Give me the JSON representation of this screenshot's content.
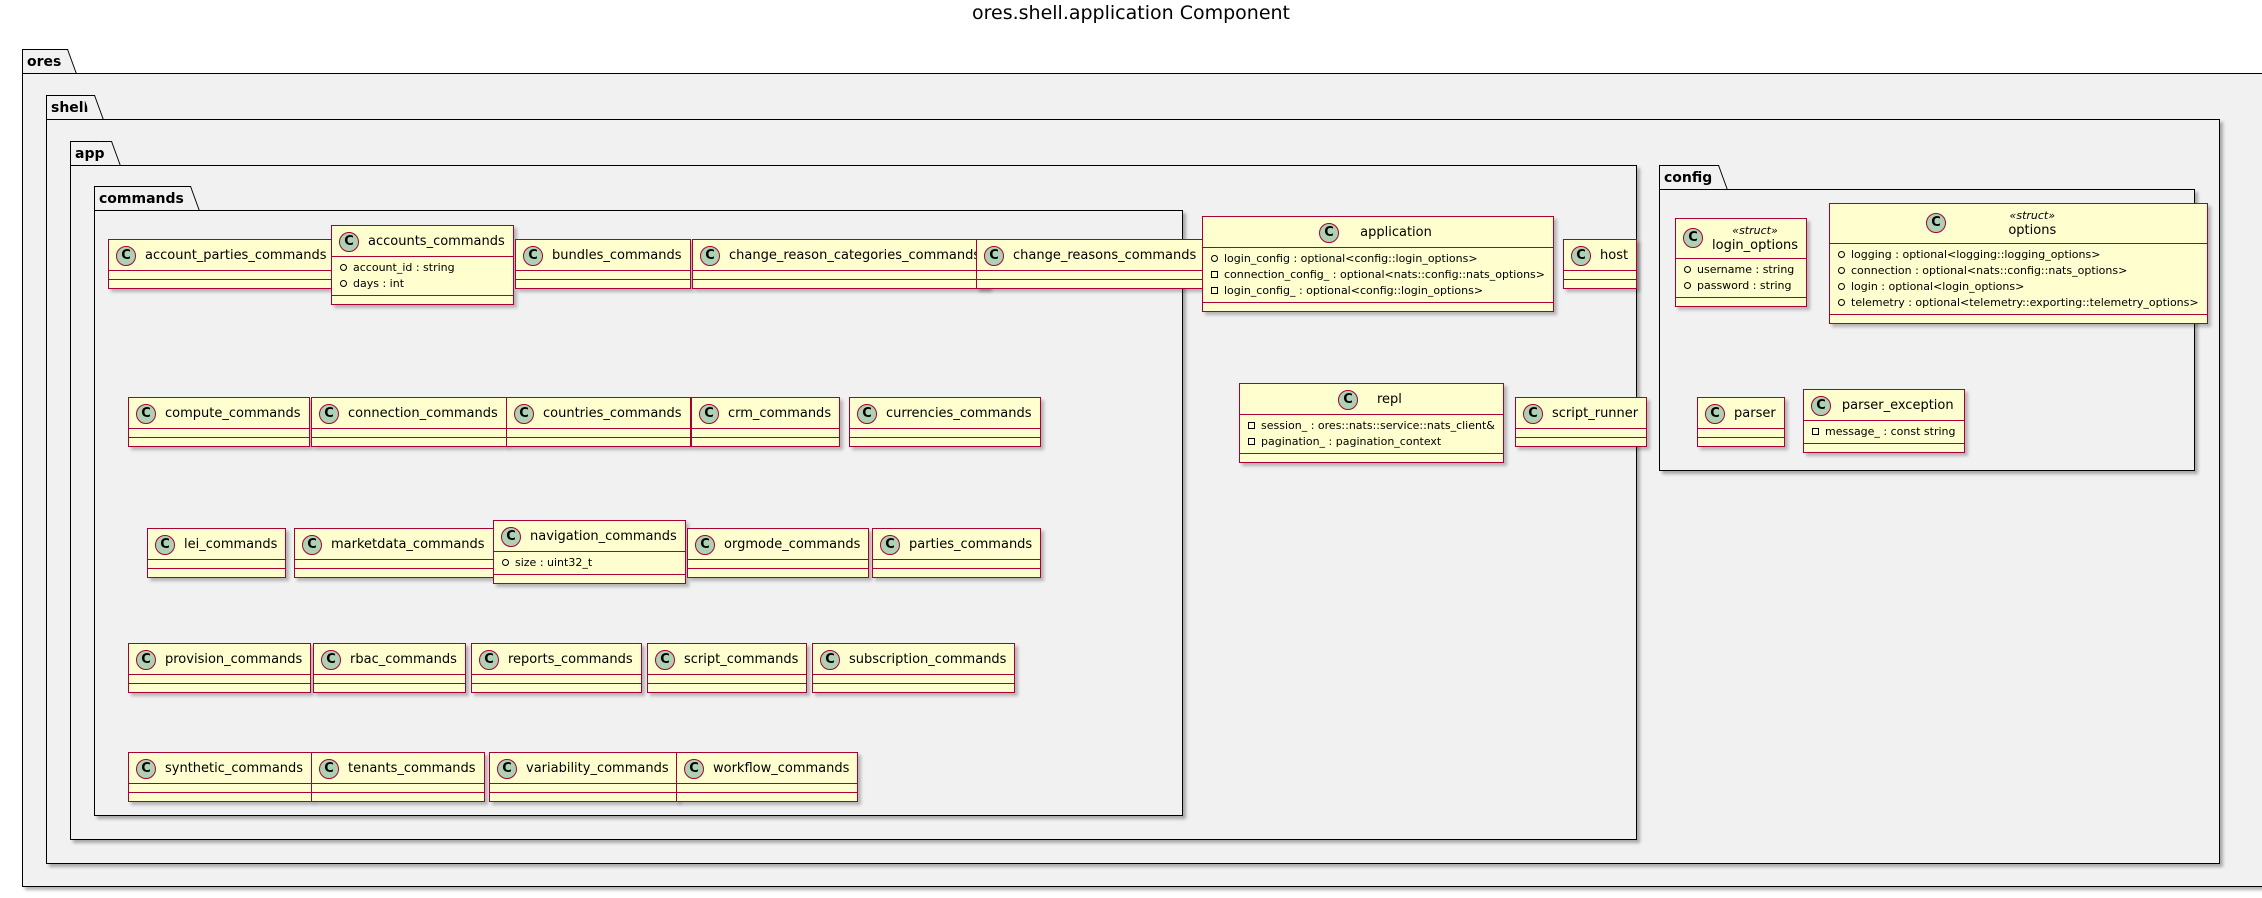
{
  "diagram_title": "ores.shell.application Component",
  "packages": {
    "ores": "ores",
    "shell": "shell",
    "app": "app",
    "commands": "commands",
    "config": "config"
  },
  "class_badge": "C",
  "commands": {
    "account_parties": "account_parties_commands",
    "accounts": {
      "name": "accounts_commands",
      "members": [
        {
          "vis": "public",
          "text": "account_id : string"
        },
        {
          "vis": "public",
          "text": "days : int"
        }
      ]
    },
    "bundles": "bundles_commands",
    "change_reason_categories": "change_reason_categories_commands",
    "change_reasons": "change_reasons_commands",
    "compute": "compute_commands",
    "connection": "connection_commands",
    "countries": "countries_commands",
    "crm": "crm_commands",
    "currencies": "currencies_commands",
    "lei": "lei_commands",
    "marketdata": "marketdata_commands",
    "navigation": {
      "name": "navigation_commands",
      "members": [
        {
          "vis": "public",
          "text": "size : uint32_t"
        }
      ]
    },
    "orgmode": "orgmode_commands",
    "parties": "parties_commands",
    "provision": "provision_commands",
    "rbac": "rbac_commands",
    "reports": "reports_commands",
    "script": "script_commands",
    "subscription": "subscription_commands",
    "synthetic": "synthetic_commands",
    "tenants": "tenants_commands",
    "variability": "variability_commands",
    "workflow": "workflow_commands"
  },
  "app_classes": {
    "application": {
      "name": "application",
      "members": [
        {
          "vis": "public",
          "text": "login_config : optional<config::login_options>"
        },
        {
          "vis": "private",
          "text": "connection_config_ : optional<nats::config::nats_options>"
        },
        {
          "vis": "private",
          "text": "login_config_ : optional<config::login_options>"
        }
      ]
    },
    "host": "host",
    "repl": {
      "name": "repl",
      "members": [
        {
          "vis": "private",
          "text": "session_ : ores::nats::service::nats_client&"
        },
        {
          "vis": "private",
          "text": "pagination_ : pagination_context"
        }
      ]
    },
    "script_runner": "script_runner"
  },
  "config_classes": {
    "login_options": {
      "stereotype": "«struct»",
      "name": "login_options",
      "members": [
        {
          "vis": "public",
          "text": "username : string"
        },
        {
          "vis": "public",
          "text": "password : string"
        }
      ]
    },
    "options": {
      "stereotype": "«struct»",
      "name": "options",
      "members": [
        {
          "vis": "public",
          "text": "logging : optional<logging::logging_options>"
        },
        {
          "vis": "public",
          "text": "connection : optional<nats::config::nats_options>"
        },
        {
          "vis": "public",
          "text": "login : optional<login_options>"
        },
        {
          "vis": "public",
          "text": "telemetry : optional<telemetry::exporting::telemetry_options>"
        }
      ]
    },
    "parser": "parser",
    "parser_exception": {
      "name": "parser_exception",
      "members": [
        {
          "vis": "private",
          "text": "message_ : const string"
        }
      ]
    }
  },
  "colors": {
    "class_fill": "#fefece",
    "class_border": "#a80036",
    "badge_fill": "#add1b2",
    "package_fill": "#f1f1f1"
  }
}
